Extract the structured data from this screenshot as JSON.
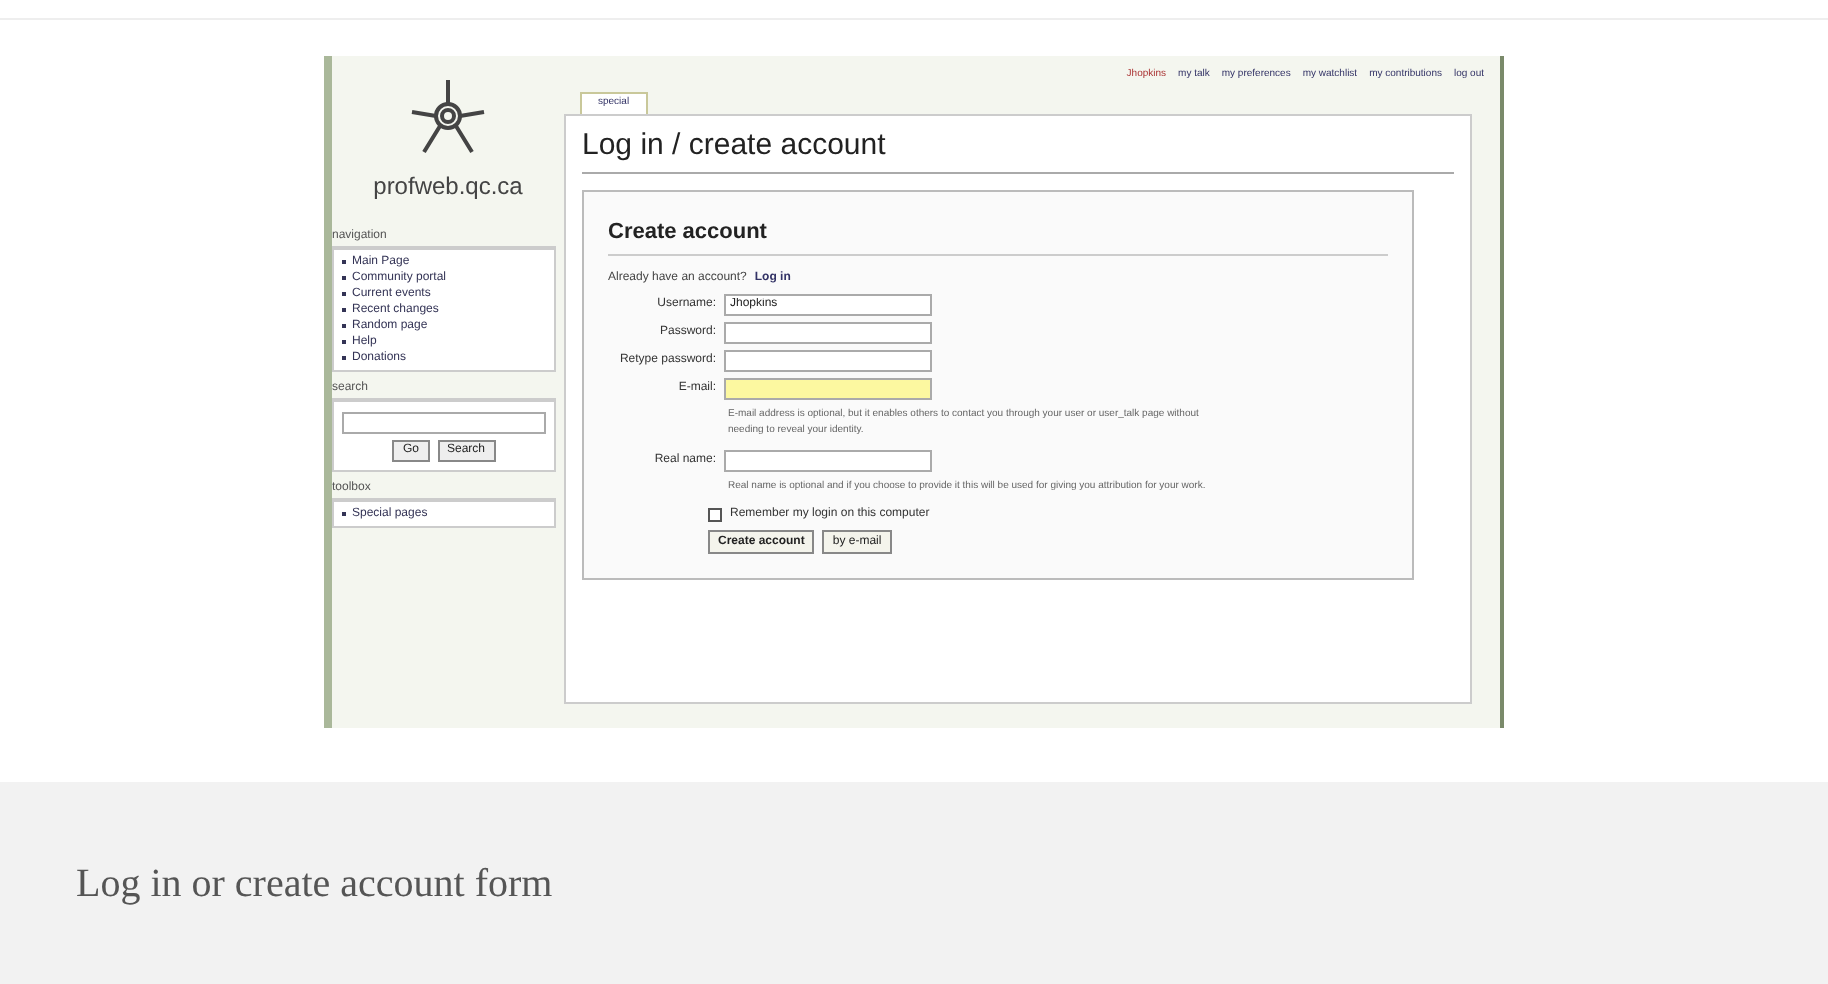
{
  "wiki": {
    "site_name": "profweb.qc.ca",
    "personal_links": [
      {
        "label": "Jhopkins",
        "kind": "user"
      },
      {
        "label": "my talk",
        "kind": "link"
      },
      {
        "label": "my preferences",
        "kind": "link"
      },
      {
        "label": "my watchlist",
        "kind": "link"
      },
      {
        "label": "my contributions",
        "kind": "link"
      },
      {
        "label": "log out",
        "kind": "link"
      }
    ],
    "tabs": [
      {
        "label": "special",
        "selected": true
      }
    ],
    "sidebar": [
      {
        "title": "navigation",
        "items": [
          "Main Page",
          "Community portal",
          "Current events",
          "Recent changes",
          "Random page",
          "Help",
          "Donations"
        ]
      },
      {
        "title": "search",
        "kind": "search",
        "buttons": [
          "Go",
          "Search"
        ]
      },
      {
        "title": "toolbox",
        "items": [
          "Special pages"
        ]
      }
    ],
    "page_title": "Log in / create account",
    "form": {
      "heading": "Create account",
      "login_prompt": "Already have an account?",
      "login_link": "Log in",
      "fields": [
        {
          "label": "Username:",
          "value": "Jhopkins",
          "highlighted": false
        },
        {
          "label": "Password:",
          "highlighted": false
        },
        {
          "label": "Retype password:",
          "highlighted": false
        },
        {
          "label": "E-mail:",
          "highlighted": true,
          "help": "E-mail address is optional, but it enables others to contact you through your user or user_talk page without needing to reveal your identity."
        },
        {
          "label": "Real name:",
          "highlighted": false,
          "help": "Real name is optional and if you choose to provide it this will be used for giving you attribution for your work."
        }
      ],
      "remember": {
        "label": "Remember my login on this computer",
        "checked": false
      },
      "buttons": [
        "Create account",
        "by e-mail"
      ]
    }
  },
  "caption": "Log in or create account form"
}
